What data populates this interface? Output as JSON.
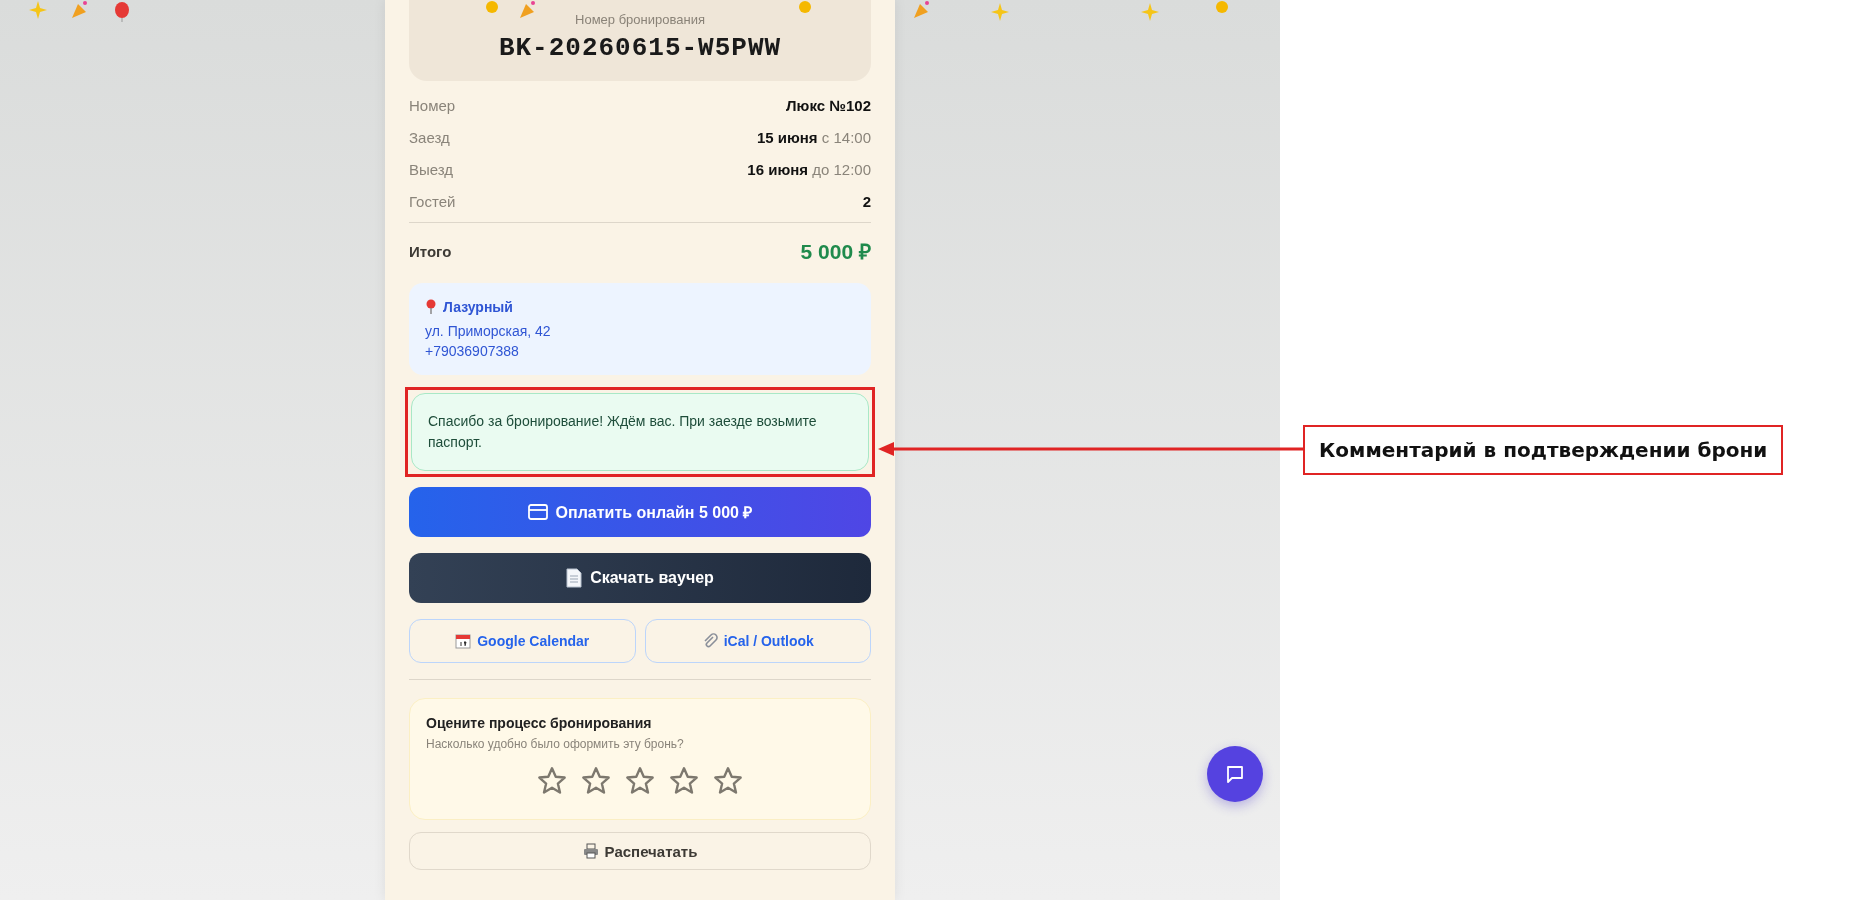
{
  "booking_code": {
    "label": "Номер бронирования",
    "value": "BK-20260615-W5PWW"
  },
  "details": [
    {
      "label": "Номер",
      "value": "Люкс №102"
    },
    {
      "label": "Заезд",
      "value": "15 июня",
      "note": "с 14:00"
    },
    {
      "label": "Выезд",
      "value": "16 июня",
      "note": "до 12:00"
    },
    {
      "label": "Гостей",
      "value": "2"
    }
  ],
  "total": {
    "label": "Итого",
    "value": "5 000 ₽"
  },
  "hotel": {
    "name": "Лазурный",
    "address": "ул. Приморская, 42",
    "phone": "+79036907388"
  },
  "comment": "Спасибо за бронирование! Ждём вас. При заезде возьмите паспорт.",
  "actions": [
    {
      "kind": "pay",
      "label": "Оплатить онлайн 5 000 ₽"
    },
    {
      "kind": "voucher",
      "label": "Скачать ваучер"
    }
  ],
  "calendar_links": [
    {
      "kind": "google",
      "label": "Google Calendar"
    },
    {
      "kind": "ical",
      "label": "iCal / Outlook"
    }
  ],
  "rating": {
    "title": "Оцените процесс бронирования",
    "subtitle": "Насколько удобно было оформить эту бронь?",
    "stars": 0
  },
  "print_button": {
    "label": "Распечатать"
  },
  "annotation": {
    "label": "Комментарий в подтверждении брони"
  }
}
